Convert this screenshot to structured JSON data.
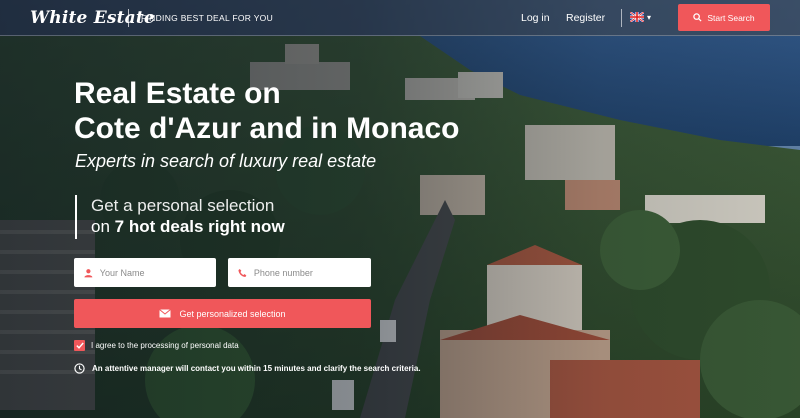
{
  "header": {
    "logo": "White Estate",
    "tagline": "FINDING BEST DEAL FOR YOU",
    "login": "Log in",
    "register": "Register",
    "language_icon": "uk-flag-icon",
    "start_search": "Start Search"
  },
  "hero": {
    "title_line1": "Real Estate on",
    "title_line2": "Cote d'Azur and in Monaco",
    "subtitle": "Experts in search of luxury real estate",
    "offer_line1": "Get a personal selection",
    "offer_line2_prefix": "on",
    "offer_line2_highlight": "7 hot deals right now"
  },
  "form": {
    "name_placeholder": "Your Name",
    "phone_placeholder": "Phone number",
    "submit_label": "Get personalized selection",
    "consent_label": "I agree to the processing of personal data",
    "consent_checked": true,
    "notice": "An attentive manager will contact you within 15 minutes and clarify the search criteria."
  },
  "colors": {
    "accent": "#f0575a",
    "header_bg": "#1e2a3a"
  }
}
